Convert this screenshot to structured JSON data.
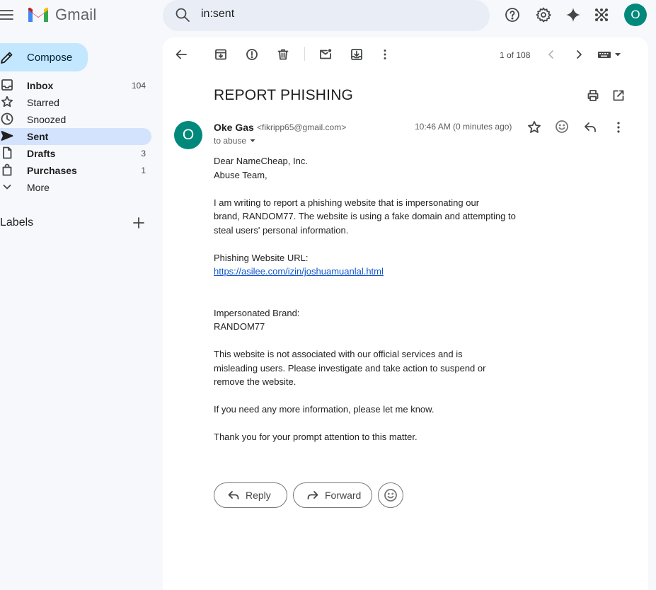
{
  "app": {
    "name": "Gmail"
  },
  "search": {
    "query": "in:sent"
  },
  "user": {
    "avatar_initial": "O"
  },
  "compose": {
    "label": "Compose"
  },
  "nav": [
    {
      "label": "Inbox",
      "count": "104",
      "bold": true
    },
    {
      "label": "Starred",
      "count": ""
    },
    {
      "label": "Snoozed",
      "count": ""
    },
    {
      "label": "Sent",
      "count": "",
      "bold": true,
      "active": true
    },
    {
      "label": "Drafts",
      "count": "3",
      "bold": true
    },
    {
      "label": "Purchases",
      "count": "1",
      "bold": true
    },
    {
      "label": "More",
      "count": ""
    }
  ],
  "labels": {
    "title": "Labels"
  },
  "toolbar": {
    "pager": "1 of 108"
  },
  "email": {
    "subject": "REPORT PHISHING",
    "sender_initial": "O",
    "sender_name": "Oke Gas",
    "sender_email": "<fikripp65@gmail.com>",
    "to": "to abuse",
    "timestamp": "10:46 AM (0 minutes ago)",
    "body": {
      "p1": [
        "Dear NameCheap, Inc.",
        "Abuse Team,"
      ],
      "p2": [
        "I am writing to report a phishing website that is impersonating our",
        "brand, RANDOM77. The website is using a fake domain and attempting to",
        "steal users' personal information."
      ],
      "url_label": "Phishing Website URL:",
      "url": "https://asilee.com/izin/joshuamuanlal.html",
      "p4": [
        "Impersonated Brand:",
        "RANDOM77"
      ],
      "p5": [
        "This website is not associated with our official services and is",
        "misleading users. Please investigate and take action to suspend or",
        "remove the website."
      ],
      "p6": "If you need any more information, please let me know.",
      "p7": "Thank you for your prompt attention to this matter."
    }
  },
  "actions": {
    "reply": "Reply",
    "forward": "Forward"
  },
  "colors": {
    "brand_teal": "#00897b",
    "compose_bg": "#c2e7ff",
    "active_nav": "#d3e3fd",
    "link": "#1155cc"
  }
}
